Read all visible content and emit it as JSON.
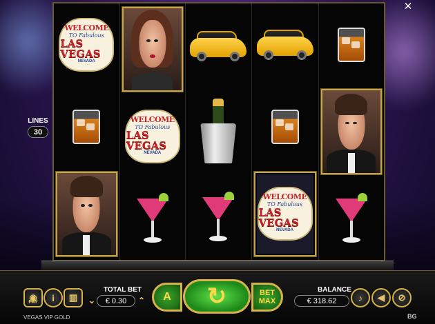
{
  "lines": {
    "label": "LINES",
    "value": "30"
  },
  "close_icon": "close-icon",
  "reels": [
    [
      "welcome-sign",
      "portrait-woman",
      "empty"
    ],
    [
      "portrait-woman",
      "welcome-sign",
      "empty"
    ],
    [
      "limo",
      "champagne-bucket",
      "martini"
    ],
    [
      "limo",
      "whisky",
      "welcome-sign"
    ],
    [
      "whisky",
      "portrait-man",
      "martini"
    ]
  ],
  "sign": {
    "welcome": "WELCOME",
    "to": "TO Fabulous",
    "city": "LAS VEGAS",
    "state": "NEVADA"
  },
  "controls": {
    "pay_label": "PAY",
    "info_icon": "info-icon",
    "history_icon": "cards-icon",
    "total_bet_label": "TOTAL BET",
    "total_bet_value": "€ 0.30",
    "autoplay_label": "A",
    "spin_icon": "spin-arrow-icon",
    "bet_max_label": "BET MAX",
    "balance_label": "BALANCE",
    "balance_value": "€ 318.62",
    "music_icon": "music-note-icon",
    "sound_icon": "speaker-icon",
    "settings_icon": "settings-icon"
  },
  "game_title": "VEGAS VIP GOLD",
  "brand": "BG"
}
